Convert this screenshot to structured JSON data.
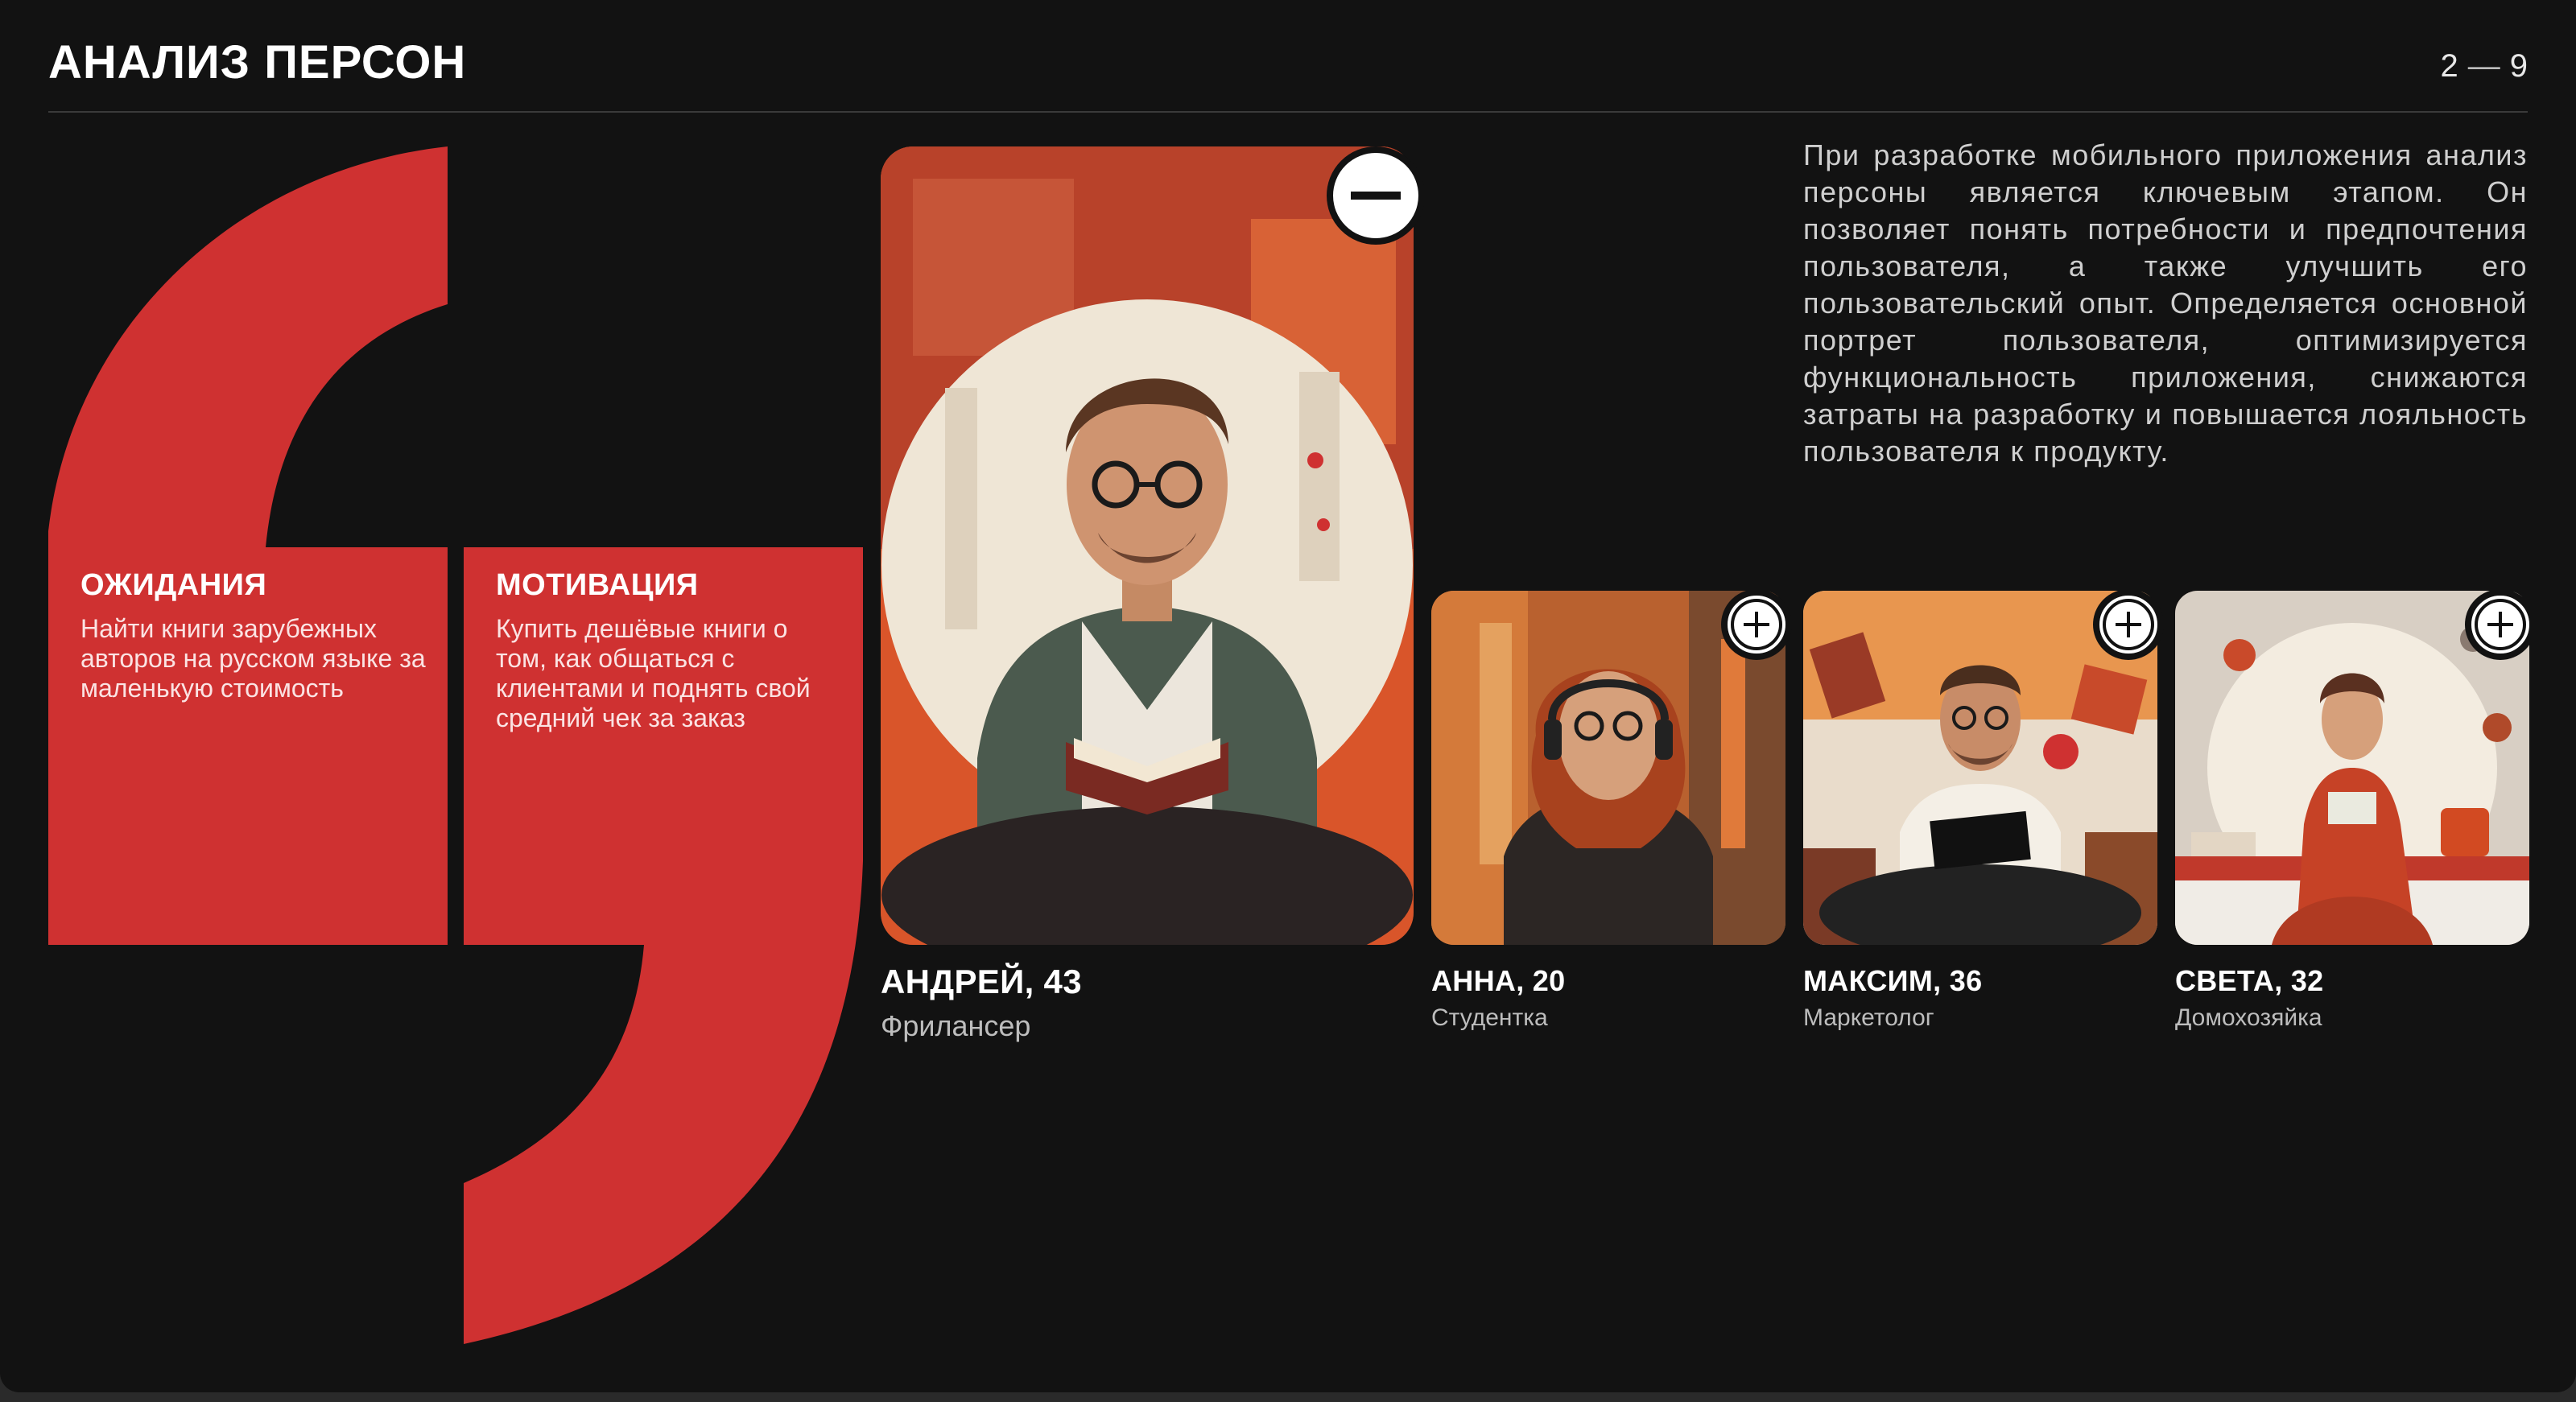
{
  "header": {
    "title": "АНАЛИЗ ПЕРСОН",
    "page_current": "2",
    "page_separator": "—",
    "page_total": "9"
  },
  "cards": {
    "expectations": {
      "title": "ОЖИДАНИЯ",
      "text": "Найти книги зарубежных авторов на русском языке за маленькую стоимость"
    },
    "motivation": {
      "title": "МОТИВАЦИЯ",
      "text": "Купить дешёвые книги о том, как общаться с клиентами и поднять свой средний чек за заказ"
    }
  },
  "description": "При разработке мобильного приложения анализ персоны является ключевым этапом. Он позволяет понять потребности и предпочтения пользователя, а также улучшить его пользовательский опыт. Определяется основной портрет пользователя, оптимизируется функциональность приложения, снижаются затраты на разработку и повышается лояльность пользователя к продукту.",
  "personas": [
    {
      "name": "АНДРЕЙ, 43",
      "role": "Фрилансер",
      "state": "expanded",
      "toggle_icon": "minus-icon"
    },
    {
      "name": "АННА, 20",
      "role": "Студентка",
      "state": "collapsed",
      "toggle_icon": "plus-icon"
    },
    {
      "name": "МАКСИМ, 36",
      "role": "Маркетолог",
      "state": "collapsed",
      "toggle_icon": "plus-icon"
    },
    {
      "name": "СВЕТА, 32",
      "role": "Домохозяйка",
      "state": "collapsed",
      "toggle_icon": "plus-icon"
    }
  ],
  "colors": {
    "background": "#121212",
    "accent_red": "#cf3131",
    "text_primary": "#ffffff",
    "text_secondary": "#bdbdbd"
  }
}
